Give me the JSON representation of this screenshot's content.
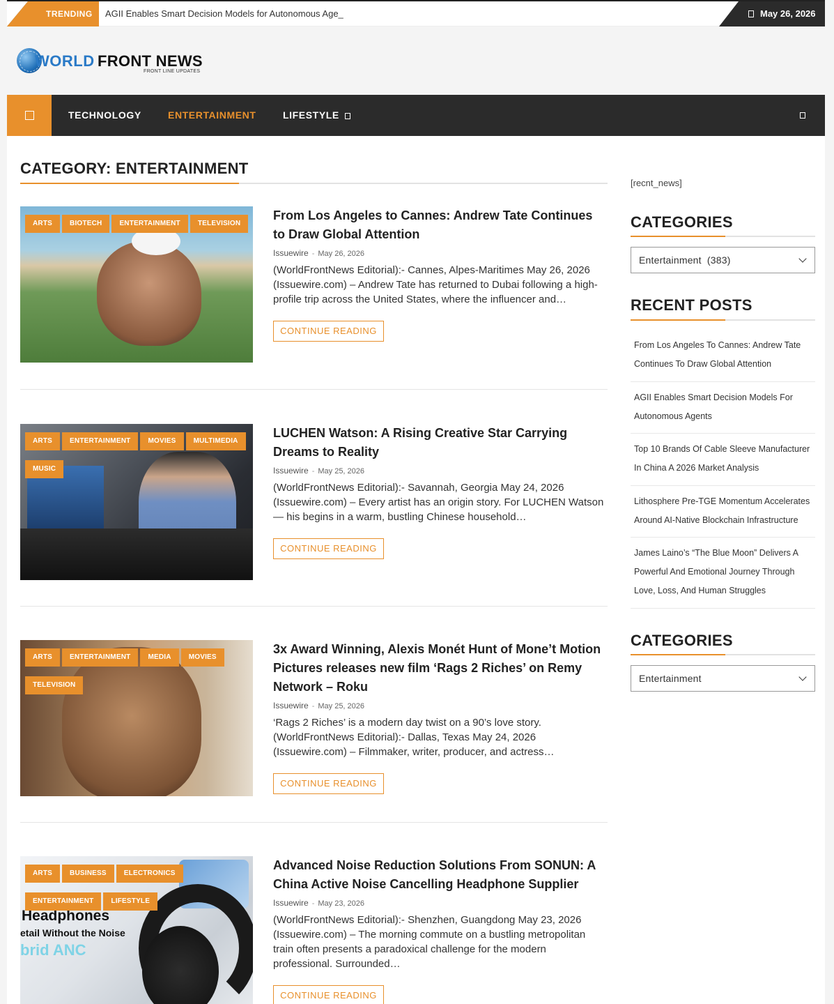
{
  "topbar": {
    "trending_label": "TRENDING",
    "trending_text": "AGII Enables Smart Decision Models for Autonomous Age_",
    "date": "May 26, 2026"
  },
  "logo": {
    "name_part1": "WORLD",
    "name_part2": "FRONT NEWS",
    "tagline": "FRONT LINE UPDATES"
  },
  "nav": {
    "items": [
      {
        "label": "TECHNOLOGY"
      },
      {
        "label": "ENTERTAINMENT"
      },
      {
        "label": "LIFESTYLE"
      }
    ]
  },
  "main": {
    "heading": "CATEGORY: ENTERTAINMENT",
    "read_more": "CONTINUE READING",
    "posts": [
      {
        "tags": [
          "ARTS",
          "BIOTECH",
          "ENTERTAINMENT",
          "TELEVISION"
        ],
        "title": "From Los Angeles to Cannes: Andrew Tate Continues to Draw Global Attention",
        "author": "Issuewire",
        "date": "May 26, 2026",
        "excerpt": "(WorldFrontNews Editorial):- Cannes, Alpes-Maritimes May 26, 2026 (Issuewire.com) – Andrew Tate has returned to Dubai following a high-profile trip across the United States, where the influencer and…"
      },
      {
        "tags": [
          "ARTS",
          "ENTERTAINMENT",
          "MOVIES",
          "MULTIMEDIA",
          "MUSIC"
        ],
        "title": "LUCHEN Watson: A Rising Creative Star Carrying Dreams to Reality",
        "author": "Issuewire",
        "date": "May 25, 2026",
        "excerpt": "(WorldFrontNews Editorial):- Savannah, Georgia May 24, 2026 (Issuewire.com) – Every artist has an origin story. For LUCHEN Watson — his begins in a warm, bustling Chinese household…"
      },
      {
        "tags": [
          "ARTS",
          "ENTERTAINMENT",
          "MEDIA",
          "MOVIES",
          "TELEVISION"
        ],
        "title": "3x Award Winning, Alexis Monét Hunt of Mone’t Motion Pictures releases new film ‘Rags 2 Riches’ on Remy Network – Roku",
        "author": "Issuewire",
        "date": "May 25, 2026",
        "excerpt": "‘Rags 2 Riches’ is a modern day twist on a 90’s love story. (WorldFrontNews Editorial):- Dallas, Texas May 24, 2026 (Issuewire.com) – Filmmaker, writer, producer, and actress…"
      },
      {
        "tags": [
          "ARTS",
          "BUSINESS",
          "ELECTRONICS",
          "ENTERTAINMENT",
          "LIFESTYLE"
        ],
        "title": "Advanced Noise Reduction Solutions From SONUN: A China Active Noise Cancelling Headphone Supplier",
        "author": "Issuewire",
        "date": "May 23, 2026",
        "excerpt": "(WorldFrontNews Editorial):- Shenzhen, Guangdong May 23, 2026 (Issuewire.com) – The morning commute on a bustling metropolitan train often presents a paradoxical challenge for the modern professional. Surrounded…",
        "image_text": [
          "Headphones",
          "etail Without the Noise",
          "brid ANC"
        ]
      }
    ]
  },
  "sidebar": {
    "shortcode": "[recnt_news]",
    "categories_title": "CATEGORIES",
    "categories_select": "Entertainment  (383)",
    "recent_title": "RECENT POSTS",
    "recent_posts": [
      "From Los Angeles To Cannes: Andrew Tate Continues To Draw Global Attention",
      "AGII Enables Smart Decision Models For Autonomous Agents",
      "Top 10 Brands Of Cable Sleeve Manufacturer In China A 2026 Market Analysis",
      "Lithosphere Pre-TGE Momentum Accelerates Around AI-Native Blockchain Infrastructure",
      "James Laino’s “The Blue Moon” Delivers A Powerful And Emotional Journey Through Love, Loss, And Human Struggles"
    ],
    "categories2_title": "CATEGORIES",
    "categories2_select": "Entertainment"
  },
  "colors": {
    "accent": "#e8902c",
    "dark": "#2b2b2b",
    "logo_blue": "#2a7ac7"
  }
}
